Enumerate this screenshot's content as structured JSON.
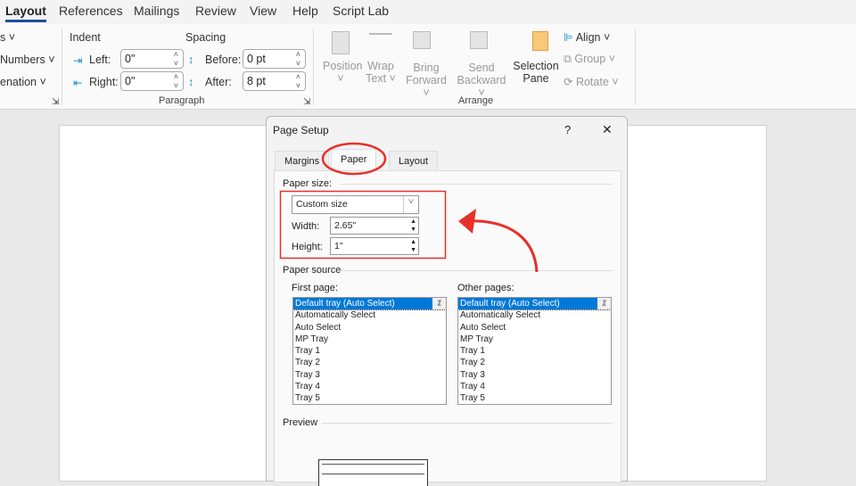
{
  "tabs": [
    "Layout",
    "References",
    "Mailings",
    "Review",
    "View",
    "Help",
    "Script Lab"
  ],
  "ribbon": {
    "left_items": [
      "s",
      "Numbers",
      "enation"
    ],
    "indent_label": "Indent",
    "spacing_label": "Spacing",
    "left_label": "Left:",
    "left_value": "0\"",
    "right_label": "Right:",
    "right_value": "0\"",
    "before_label": "Before:",
    "before_value": "0 pt",
    "after_label": "After:",
    "after_value": "8 pt",
    "paragraph_group": "Paragraph",
    "arrange": {
      "position": "Position",
      "wrap": "Wrap",
      "wrap2": "Text",
      "bring": "Bring",
      "bring2": "Forward",
      "send": "Send",
      "send2": "Backward",
      "selection": "Selection",
      "selection2": "Pane",
      "align": "Align",
      "group": "Group",
      "rotate": "Rotate",
      "group_label": "Arrange"
    }
  },
  "dialog": {
    "title": "Page Setup",
    "help": "?",
    "close": "✕",
    "tabs": [
      "Margins",
      "Paper",
      "Layout"
    ],
    "paper_size_label": "Paper size:",
    "paper_size": "Custom size",
    "width_label": "Width:",
    "width_value": "2.65\"",
    "height_label": "Height:",
    "height_value": "1\"",
    "paper_source_label": "Paper source",
    "first_page_label": "First page:",
    "other_pages_label": "Other pages:",
    "trays": [
      "Default tray (Auto Select)",
      "Automatically Select",
      "Auto Select",
      "MP Tray",
      "Tray 1",
      "Tray 2",
      "Tray 3",
      "Tray 4",
      "Tray 5"
    ],
    "preview_label": "Preview"
  },
  "colors": {
    "annotation": "#e8302a",
    "accent": "#1f4e9e",
    "selection": "#0078d7"
  }
}
